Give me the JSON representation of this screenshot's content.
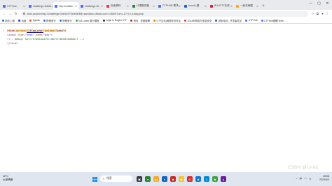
{
  "browser": {
    "tabs": [
      {
        "label": "CTFHub"
      },
      {
        "label": "challenge-5cb5c"
      },
      {
        "label": "http://challen"
      },
      {
        "label": "challenge-5c"
      },
      {
        "label": "页面源码"
      },
      {
        "label": "代理服务器"
      },
      {
        "label": "CTFHUB 靶场"
      },
      {
        "label": "buuctf_题"
      },
      {
        "label": "BUUCTF在线"
      },
      {
        "label": "一起来刷题"
      }
    ],
    "active_tab": 2,
    "url": "view-source:http://challenge-5cb5c973cfe5836b.sandbox.ctfhub.com:10800/?url=127.0.0.1/flag.php",
    "bookmarks": [
      {
        "label": "新手上路",
        "color": "#1a73e8"
      },
      {
        "label": "百度",
        "color": "#2932e1"
      },
      {
        "label": "Agoda",
        "color": "#e94e3c"
      },
      {
        "label": "携程旅行",
        "color": "#2577e3"
      },
      {
        "label": "携程旅行",
        "color": "#2577e3"
      },
      {
        "label": "W3 Learn 推行课程",
        "color": "#34a853"
      },
      {
        "label": "Login to Bugku CTF",
        "color": "#333333"
      },
      {
        "label": "首页 - 吾爱破解",
        "color": "#c62828"
      },
      {
        "label": "CTF论坛|网络安全社区",
        "color": "#f57c00"
      },
      {
        "label": "2024年网络与信息安全",
        "color": "#e53935"
      },
      {
        "label": "网安培训 - 开发者社区",
        "color": "#1565c0"
      },
      {
        "label": "CTFHub",
        "color": "#4a6cf7"
      },
      {
        "label": "CTFHub题解 Web...",
        "color": "#4a6cf7"
      }
    ]
  },
  "source": {
    "line1_tag_open": "<form",
    "line1_attr1": " action=",
    "line1_val1": "\"/flag.php\"",
    "line1_attr2": " method=",
    "line1_val2": "\"post\"",
    "line1_close": ">",
    "line2_tag": "<input",
    "line2_attr1": " type=",
    "line2_val1": "\"text\"",
    "line2_attr2": " name=",
    "line2_val2": "\"key\"",
    "line2_close": ">",
    "line3_comment": "<!-- debug: key=f57a09aa3c9cfd637cf8256cbd6db7r -->",
    "line4_tag": "</form>"
  },
  "watermark": "CSDN @Lindq",
  "taskbar": {
    "weather_temp": "22°C",
    "weather_desc": "大部晴朗",
    "search_placeholder": "搜索",
    "lang": "中",
    "time": "15:08",
    "date": "2024/4/4"
  }
}
